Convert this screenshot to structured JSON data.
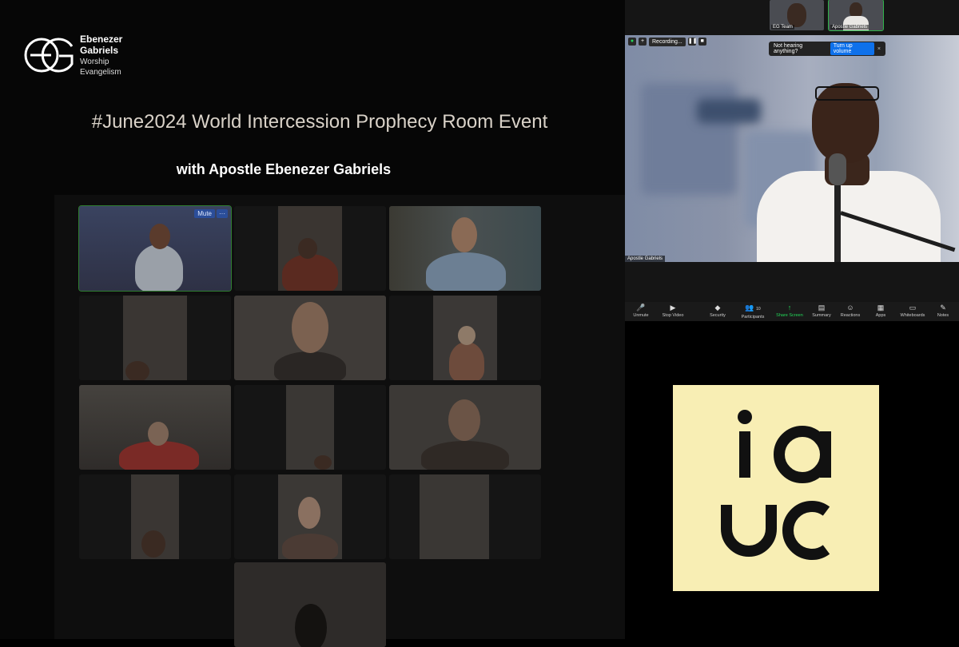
{
  "logo": {
    "line1": "Ebenezer",
    "line2": "Gabriels",
    "line3": "Worship",
    "line4": "Evangelism"
  },
  "event": {
    "title": "#June2024 World Intercession Prophecy Room Event",
    "subtitle": "with Apostle Ebenezer Gabriels"
  },
  "gallery": {
    "mute_label": "Mute",
    "more_label": "···"
  },
  "zoom": {
    "thumbnails": [
      {
        "label": "EG Team"
      },
      {
        "label": "Apostle Gabriels"
      }
    ],
    "recording_label": "Recording...",
    "notice_text": "Not hearing anything?",
    "notice_button": "Turn up volume",
    "notice_close": "×",
    "speaker_name": "Apostle Gabriels",
    "toolbar": [
      {
        "icon": "🎤",
        "label": "Unmute"
      },
      {
        "icon": "▶",
        "label": "Stop Video"
      },
      {
        "icon": "◆",
        "label": "Security"
      },
      {
        "icon": "👥",
        "label": "Participants"
      },
      {
        "icon": "↑",
        "label": "Share Screen"
      },
      {
        "icon": "▤",
        "label": "Summary"
      },
      {
        "icon": "☺",
        "label": "Reactions"
      },
      {
        "icon": "▦",
        "label": "Apps"
      },
      {
        "icon": "▭",
        "label": "Whiteboards"
      },
      {
        "icon": "✎",
        "label": "Notes"
      }
    ],
    "participants_count": "10"
  },
  "colors": {
    "share_green": "#23d959",
    "notice_blue": "#0e71eb",
    "brand_bg": "#f8eeb4"
  }
}
